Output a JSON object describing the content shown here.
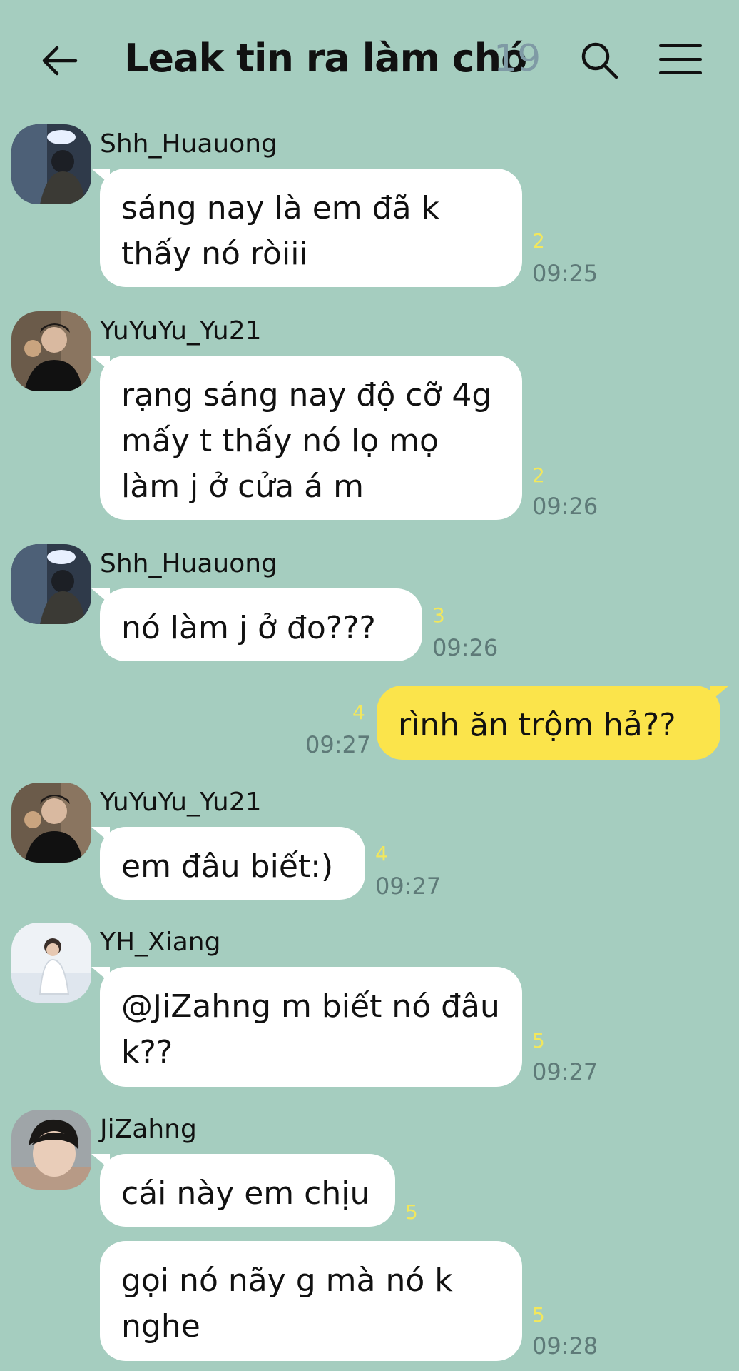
{
  "header": {
    "title": "Leak tin ra làm chó",
    "member_count": "19",
    "back_icon": "back-arrow-icon",
    "search_icon": "search-icon",
    "menu_icon": "hamburger-menu-icon"
  },
  "messages": [
    {
      "sender": "Shh_Huauong",
      "text": "sáng nay là em đã k thấy nó ròiii",
      "unread": "2",
      "time": "09:25"
    },
    {
      "sender": "YuYuYu_Yu21",
      "text": "rạng sáng nay độ cỡ 4g mấy t thấy nó lọ mọ làm j ở cửa á m",
      "unread": "2",
      "time": "09:26"
    },
    {
      "sender": "Shh_Huauong",
      "text": "nó làm j ở đo???",
      "unread": "3",
      "time": "09:26"
    },
    {
      "sender": "",
      "text": "rình ăn trộm hả??",
      "unread": "4",
      "time": "09:27"
    },
    {
      "sender": "YuYuYu_Yu21",
      "text": "em đâu biết:)",
      "unread": "4",
      "time": "09:27"
    },
    {
      "sender": "YH_Xiang",
      "text": "@JiZahng m biết nó đâu k??",
      "unread": "5",
      "time": "09:27"
    },
    {
      "sender": "JiZahng",
      "text": "cái này em chịu",
      "unread": "5",
      "time": ""
    },
    {
      "sender": "",
      "text": "gọi nó nãy g mà nó k nghe",
      "unread": "5",
      "time": "09:28"
    }
  ]
}
